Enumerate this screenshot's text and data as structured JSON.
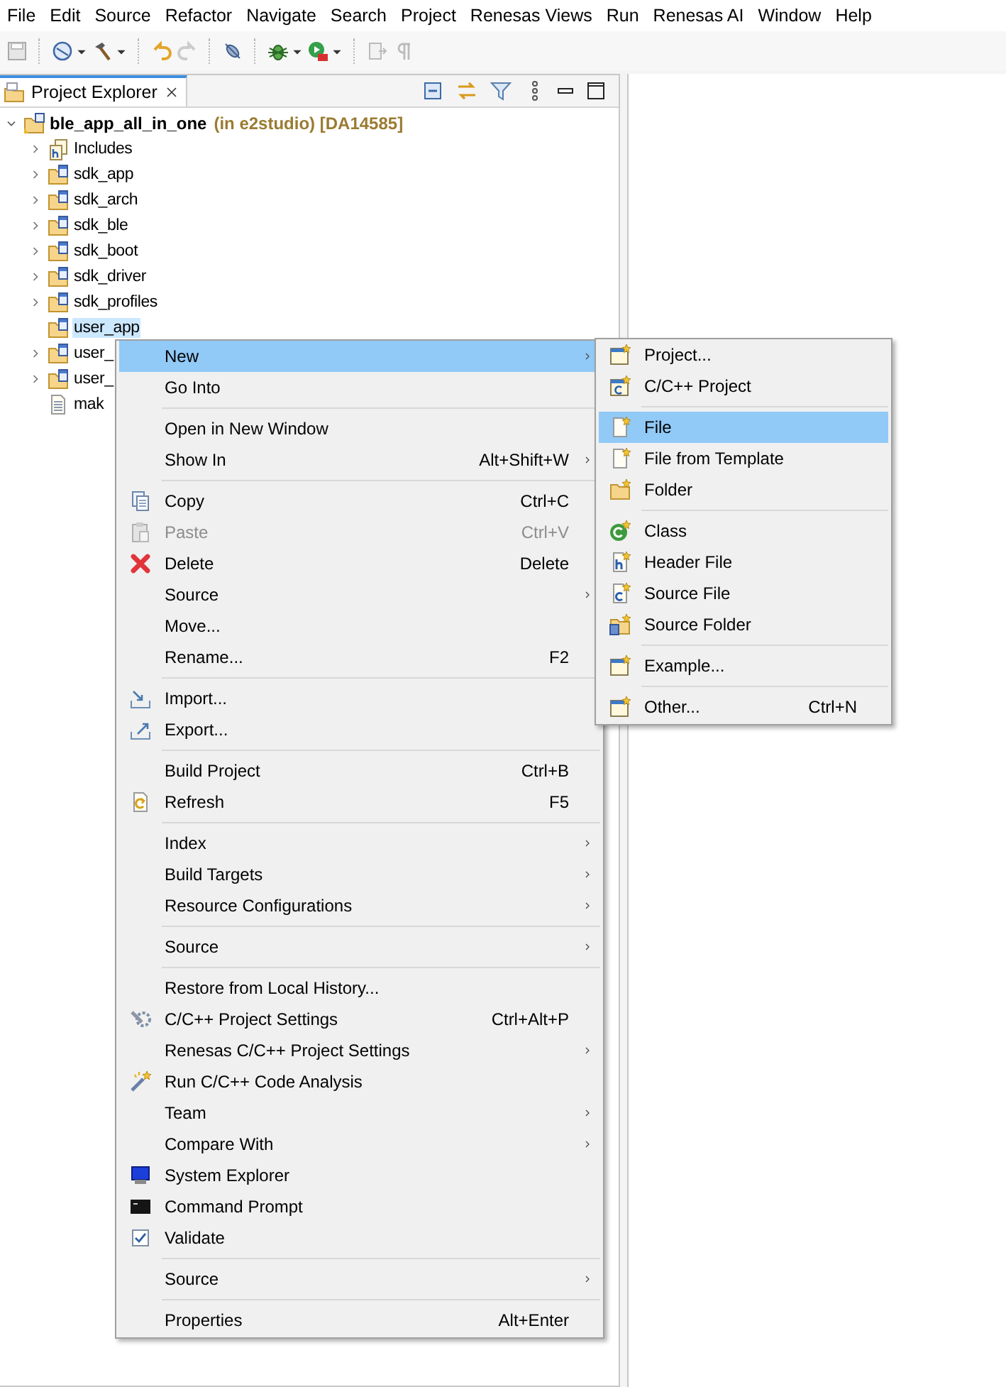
{
  "menu_bar": [
    "File",
    "Edit",
    "Source",
    "Refactor",
    "Navigate",
    "Search",
    "Project",
    "Renesas Views",
    "Run",
    "Renesas AI",
    "Window",
    "Help"
  ],
  "view": {
    "tab": {
      "label": "Project Explorer",
      "selected": true
    }
  },
  "tree": {
    "root": {
      "label": "ble_app_all_in_one",
      "suffix": "(in e2studio) [DA14585]",
      "expanded": true,
      "children": [
        {
          "label": "Includes",
          "kind": "includes",
          "has_chevron": true,
          "expanded": false,
          "selected": false
        },
        {
          "label": "sdk_app",
          "kind": "source_folder",
          "has_chevron": true,
          "expanded": false,
          "selected": false
        },
        {
          "label": "sdk_arch",
          "kind": "source_folder",
          "has_chevron": true,
          "expanded": false,
          "selected": false
        },
        {
          "label": "sdk_ble",
          "kind": "source_folder",
          "has_chevron": true,
          "expanded": false,
          "selected": false
        },
        {
          "label": "sdk_boot",
          "kind": "source_folder",
          "has_chevron": true,
          "expanded": false,
          "selected": false
        },
        {
          "label": "sdk_driver",
          "kind": "source_folder",
          "has_chevron": true,
          "expanded": false,
          "selected": false
        },
        {
          "label": "sdk_profiles",
          "kind": "source_folder",
          "has_chevron": true,
          "expanded": false,
          "selected": false
        },
        {
          "label": "user_app",
          "kind": "source_folder",
          "has_chevron": false,
          "selected": true
        },
        {
          "label": "user_",
          "kind": "source_folder",
          "has_chevron": true,
          "expanded": false,
          "selected": false
        },
        {
          "label": "user_",
          "kind": "source_folder",
          "has_chevron": true,
          "expanded": false,
          "selected": false
        },
        {
          "label": "mak",
          "kind": "file",
          "has_chevron": false,
          "selected": false
        }
      ]
    }
  },
  "context_menu": {
    "sections": [
      [
        {
          "label": "New",
          "submenu": true,
          "selected": true,
          "disabled": false
        },
        {
          "label": "Go Into",
          "submenu": false,
          "selected": false,
          "disabled": false
        }
      ],
      [
        {
          "label": "Open in New Window",
          "submenu": false,
          "selected": false,
          "disabled": false
        },
        {
          "label": "Show In",
          "shortcut": "Alt+Shift+W",
          "submenu": true,
          "selected": false,
          "disabled": false
        }
      ],
      [
        {
          "label": "Copy",
          "shortcut": "Ctrl+C",
          "submenu": false,
          "selected": false,
          "disabled": false
        },
        {
          "label": "Paste",
          "shortcut": "Ctrl+V",
          "submenu": false,
          "selected": false,
          "disabled": true
        },
        {
          "label": "Delete",
          "shortcut": "Delete",
          "submenu": false,
          "selected": false,
          "disabled": false
        },
        {
          "label": "Source",
          "submenu": true,
          "selected": false,
          "disabled": false
        },
        {
          "label": "Move...",
          "submenu": false,
          "selected": false,
          "disabled": false
        },
        {
          "label": "Rename...",
          "shortcut": "F2",
          "submenu": false,
          "selected": false,
          "disabled": false
        }
      ],
      [
        {
          "label": "Import...",
          "submenu": false,
          "selected": false,
          "disabled": false
        },
        {
          "label": "Export...",
          "submenu": false,
          "selected": false,
          "disabled": false
        }
      ],
      [
        {
          "label": "Build Project",
          "shortcut": "Ctrl+B",
          "submenu": false,
          "selected": false,
          "disabled": false
        },
        {
          "label": "Refresh",
          "shortcut": "F5",
          "submenu": false,
          "selected": false,
          "disabled": false
        }
      ],
      [
        {
          "label": "Index",
          "submenu": true,
          "selected": false,
          "disabled": false
        },
        {
          "label": "Build Targets",
          "submenu": true,
          "selected": false,
          "disabled": false
        },
        {
          "label": "Resource Configurations",
          "submenu": true,
          "selected": false,
          "disabled": false
        }
      ],
      [
        {
          "label": "Source",
          "submenu": true,
          "selected": false,
          "disabled": false
        }
      ],
      [
        {
          "label": "Restore from Local History...",
          "submenu": false,
          "selected": false,
          "disabled": false
        },
        {
          "label": "C/C++ Project Settings",
          "shortcut": "Ctrl+Alt+P",
          "submenu": false,
          "selected": false,
          "disabled": false
        },
        {
          "label": "Renesas C/C++ Project Settings",
          "submenu": true,
          "selected": false,
          "disabled": false
        },
        {
          "label": "Run C/C++ Code Analysis",
          "submenu": false,
          "selected": false,
          "disabled": false
        },
        {
          "label": "Team",
          "submenu": true,
          "selected": false,
          "disabled": false
        },
        {
          "label": "Compare With",
          "submenu": true,
          "selected": false,
          "disabled": false
        },
        {
          "label": "System Explorer",
          "submenu": false,
          "selected": false,
          "disabled": false
        },
        {
          "label": "Command Prompt",
          "submenu": false,
          "selected": false,
          "disabled": false
        },
        {
          "label": "Validate",
          "submenu": false,
          "selected": false,
          "disabled": false
        }
      ],
      [
        {
          "label": "Source",
          "submenu": true,
          "selected": false,
          "disabled": false
        }
      ],
      [
        {
          "label": "Properties",
          "shortcut": "Alt+Enter",
          "submenu": false,
          "selected": false,
          "disabled": false
        }
      ]
    ]
  },
  "submenu": {
    "sections": [
      [
        {
          "label": "Project...",
          "submenu": false,
          "selected": false,
          "disabled": false
        },
        {
          "label": "C/C++ Project",
          "submenu": false,
          "selected": false,
          "disabled": false
        }
      ],
      [
        {
          "label": "File",
          "submenu": false,
          "selected": true,
          "disabled": false
        },
        {
          "label": "File from Template",
          "submenu": false,
          "selected": false,
          "disabled": false
        },
        {
          "label": "Folder",
          "submenu": false,
          "selected": false,
          "disabled": false
        }
      ],
      [
        {
          "label": "Class",
          "submenu": false,
          "selected": false,
          "disabled": false
        },
        {
          "label": "Header File",
          "submenu": false,
          "selected": false,
          "disabled": false
        },
        {
          "label": "Source File",
          "submenu": false,
          "selected": false,
          "disabled": false
        },
        {
          "label": "Source Folder",
          "submenu": false,
          "selected": false,
          "disabled": false
        }
      ],
      [
        {
          "label": "Example...",
          "submenu": false,
          "selected": false,
          "disabled": false
        }
      ],
      [
        {
          "label": "Other...",
          "shortcut": "Ctrl+N",
          "submenu": false,
          "selected": false,
          "disabled": false
        }
      ]
    ]
  }
}
